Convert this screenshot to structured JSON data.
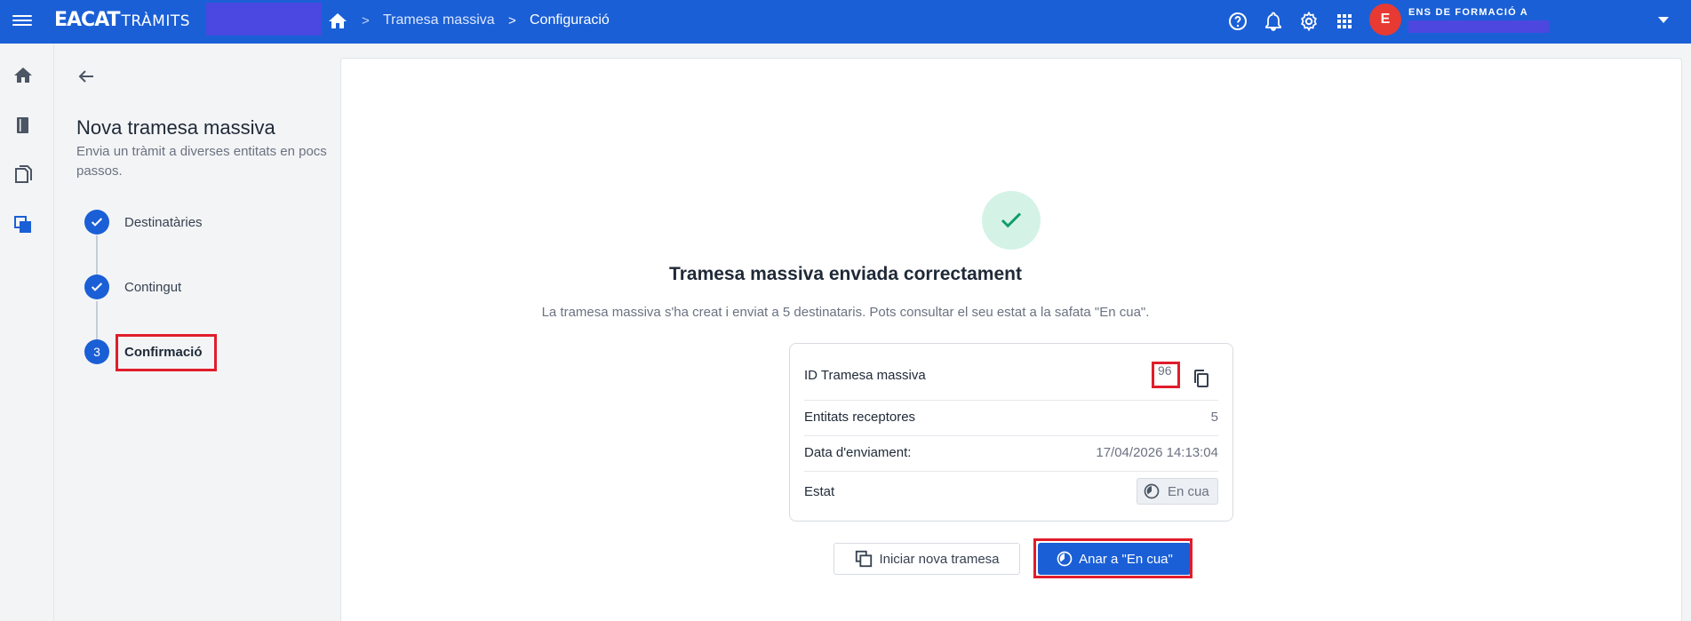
{
  "app": {
    "logo_bold": "EACAT",
    "logo_light": "TRÀMITS"
  },
  "breadcrumb": {
    "items": [
      "Tramesa massiva",
      "Configuració"
    ]
  },
  "user": {
    "initial": "E",
    "org_name": "ENS DE FORMACIÓ A"
  },
  "wizard": {
    "title": "Nova tramesa massiva",
    "subtitle": "Envia un tràmit a diverses entitats en pocs passos.",
    "steps": [
      {
        "label": "Destinatàries",
        "state": "done"
      },
      {
        "label": "Contingut",
        "state": "done"
      },
      {
        "label": "Confirmació",
        "state": "active",
        "number": "3"
      }
    ]
  },
  "result": {
    "title": "Tramesa massiva enviada correctament",
    "message": "La tramesa massiva s'ha creat i enviat a 5 destinataris. Pots consultar el seu estat a la safata \"En cua\"."
  },
  "summary": {
    "id_label": "ID Tramesa massiva",
    "id_value": "96",
    "entities_label": "Entitats receptores",
    "entities_value": "5",
    "date_label": "Data d'enviament:",
    "date_value": "17/04/2026 14:13:04",
    "state_label": "Estat",
    "state_value": "En cua"
  },
  "actions": {
    "new_label": "Iniciar nova tramesa",
    "goto_label": "Anar a \"En cua\""
  },
  "colors": {
    "primary": "#1a5fd6",
    "success_bg": "#d4f3e6",
    "success": "#0f9d6e",
    "highlight": "#e01d2b",
    "avatar": "#e63a32"
  }
}
